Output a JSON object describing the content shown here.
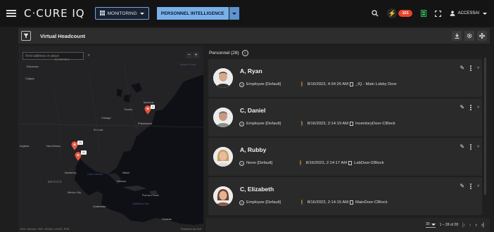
{
  "header": {
    "app_title": "C·CURE IQ",
    "monitoring_label": "MONITORING",
    "personnel_label": "PERSONNEL INTELLIGENCE",
    "alarm_count": "101",
    "user_name": "ACCESSAI",
    "icons": [
      "menu-icon",
      "grid-icon",
      "search-icon",
      "bolt-icon",
      "door-icon",
      "fullscreen-icon",
      "user-icon"
    ]
  },
  "subbar": {
    "title": "Virtual Headcount",
    "icons": [
      "filter-icon",
      "download-icon",
      "settings-icon",
      "expand-icon"
    ]
  },
  "map": {
    "search_placeholder": "Find address or place",
    "zoom_out": "−",
    "zoom_in": "+",
    "attribution": "Esri, Garmin, FAO, NOAA, USGS, EPA",
    "powered_by": "Powered by Esri",
    "places": {
      "canada": "CANADA",
      "edmonton": "Edmonton",
      "calgary": "Calgary",
      "montreal": "Montreal",
      "toronto": "Toronto",
      "chicago": "Chicago",
      "philadelphia": "Philadelphia",
      "st_louis": "St Louis",
      "angeles": "Angeles",
      "new_mexico": "New Mexico",
      "monterrey": "Monterrey",
      "gulf": "Gulf of Mexico",
      "mexico": "MEXICO",
      "mexico_city": "Mexico City",
      "havana": "Havana",
      "miami": "Miami",
      "guatemala": "Guatemala",
      "caribbean": "Caribbean Sea",
      "puerto_prince": "Port-au-Prince",
      "caracas": "Caracas",
      "atlantic": "Atlantic Ocean"
    },
    "pins": [
      {
        "label": "4"
      },
      {
        "label": "13"
      },
      {
        "label": "11"
      }
    ]
  },
  "personnel": {
    "title": "Personnel (28)",
    "info_icon": "info-icon",
    "items": [
      {
        "name": "A, Ryan",
        "type": "Employee [Default]",
        "time": "8/16/2023, 4:34:20 AM",
        "door": "_IQ - Main Lobby Door",
        "type_icon": "clearance-icon"
      },
      {
        "name": "C, Daniel",
        "type": "Employee [Default]",
        "time": "8/16/2023, 2:14:19 AM",
        "door": "InventoryDoor-CBlock",
        "type_icon": "clearance-icon"
      },
      {
        "name": "A, Rubby",
        "type": "None [Default]",
        "time": "8/16/2023, 2:14:17 AM",
        "door": "LabDoor-DBlock",
        "type_icon": "none-icon"
      },
      {
        "name": "C, Elizabeth",
        "type": "Employee [Default]",
        "time": "8/16/2023, 2:14:15 AM",
        "door": "MainDoor-CBlock",
        "type_icon": "clearance-icon"
      }
    ],
    "pager": {
      "page_size": "30",
      "range": "1 – 28 of 28"
    }
  },
  "colors": {
    "accent": "#7ab0e8",
    "alarm": "#e8432d",
    "pin": "#e8543f",
    "success": "#2ebd59"
  }
}
